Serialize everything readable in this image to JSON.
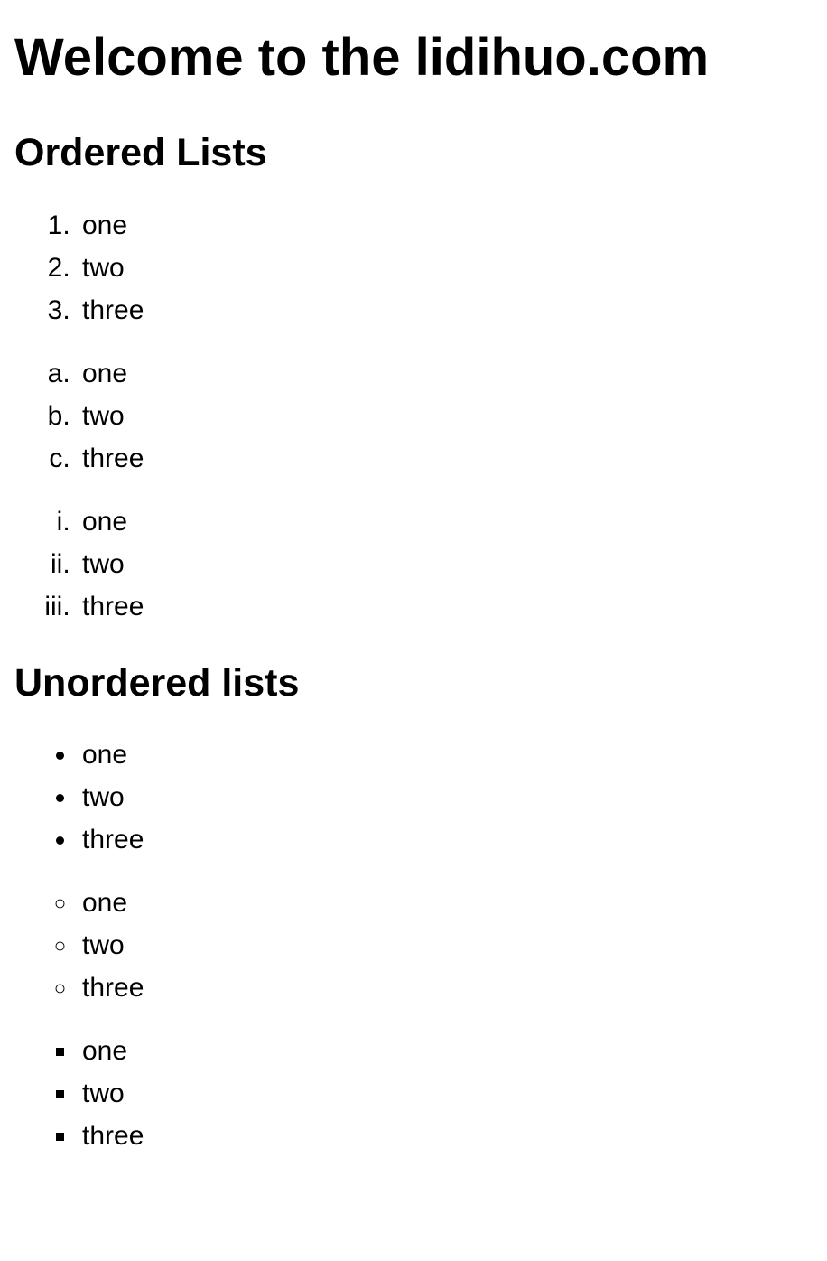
{
  "title": "Welcome to the lidihuo.com",
  "ordered_heading": "Ordered Lists",
  "unordered_heading": "Unordered lists",
  "ordered": {
    "decimal": [
      "one",
      "two",
      "three"
    ],
    "alpha": [
      "one",
      "two",
      "three"
    ],
    "roman": [
      "one",
      "two",
      "three"
    ]
  },
  "unordered": {
    "disc": [
      "one",
      "two",
      "three"
    ],
    "circle": [
      "one",
      "two",
      "three"
    ],
    "square": [
      "one",
      "two",
      "three"
    ]
  }
}
